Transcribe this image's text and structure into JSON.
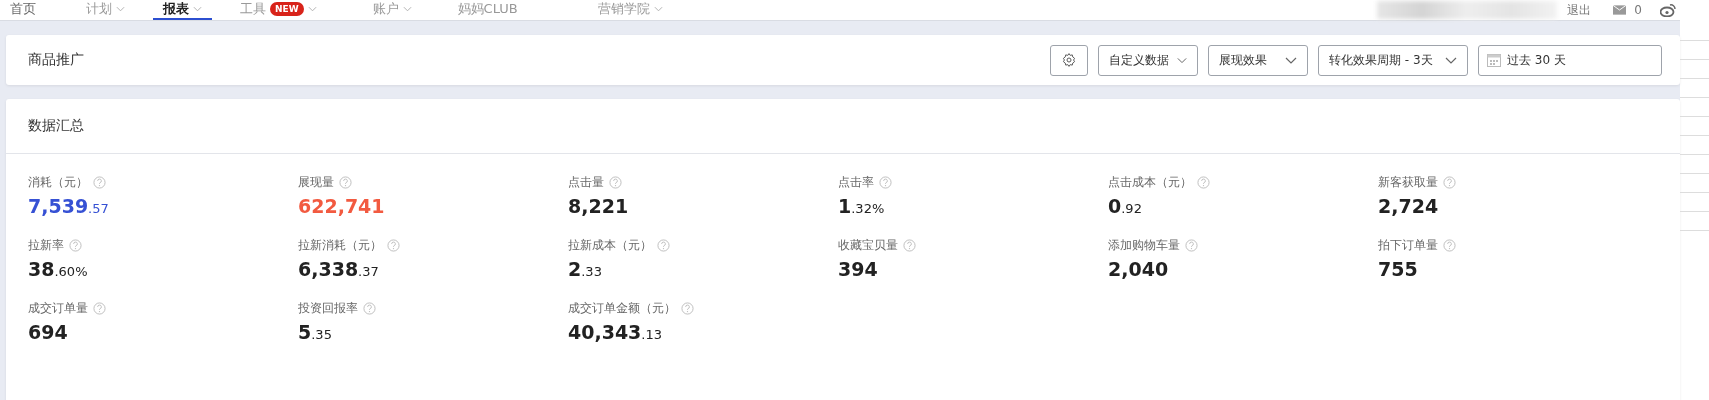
{
  "nav": {
    "items": [
      {
        "label": "首页",
        "selected": false,
        "dropdown": false
      },
      {
        "label": "计划",
        "selected": false,
        "dropdown": true
      },
      {
        "label": "报表",
        "selected": true,
        "dropdown": true
      },
      {
        "label": "工具",
        "selected": false,
        "dropdown": true,
        "badge": "NEW"
      },
      {
        "label": "账户",
        "selected": false,
        "dropdown": true
      },
      {
        "label": "妈妈CLUB",
        "selected": false,
        "dropdown": false
      },
      {
        "label": "营销学院",
        "selected": false,
        "dropdown": true
      }
    ],
    "logout": "退出",
    "messages": "0"
  },
  "toolbar": {
    "title": "商品推广",
    "selects": [
      "自定义数据",
      "展现效果",
      "转化效果周期 - 3天"
    ],
    "date": "过去 30 天"
  },
  "summary": {
    "title": "数据汇总",
    "metrics": [
      {
        "label": "消耗（元）",
        "value": "7,539",
        "decimals": ".57",
        "color": "#3651d4"
      },
      {
        "label": "展现量",
        "value": "622,741",
        "color": "#f25a40"
      },
      {
        "label": "点击量",
        "value": "8,221",
        "color": "#222222"
      },
      {
        "label": "点击率",
        "value": "1",
        "decimals": ".32%",
        "color": "#222222"
      },
      {
        "label": "点击成本（元）",
        "value": "0",
        "decimals": ".92",
        "color": "#222222"
      },
      {
        "label": "新客获取量",
        "value": "2,724",
        "color": "#222222"
      },
      {
        "label": "拉新率",
        "value": "38",
        "decimals": ".60%",
        "color": "#222222"
      },
      {
        "label": "拉新消耗（元）",
        "value": "6,338",
        "decimals": ".37",
        "color": "#222222"
      },
      {
        "label": "拉新成本（元）",
        "value": "2",
        "decimals": ".33",
        "color": "#222222"
      },
      {
        "label": "收藏宝贝量",
        "value": "394",
        "color": "#222222"
      },
      {
        "label": "添加购物车量",
        "value": "2,040",
        "color": "#222222"
      },
      {
        "label": "拍下订单量",
        "value": "755",
        "color": "#222222"
      },
      {
        "label": "成交订单量",
        "value": "694",
        "color": "#222222"
      },
      {
        "label": "投资回报率",
        "value": "5",
        "decimals": ".35",
        "color": "#222222"
      },
      {
        "label": "成交订单金额（元）",
        "value": "40,343",
        "decimals": ".13",
        "color": "#222222"
      }
    ]
  }
}
